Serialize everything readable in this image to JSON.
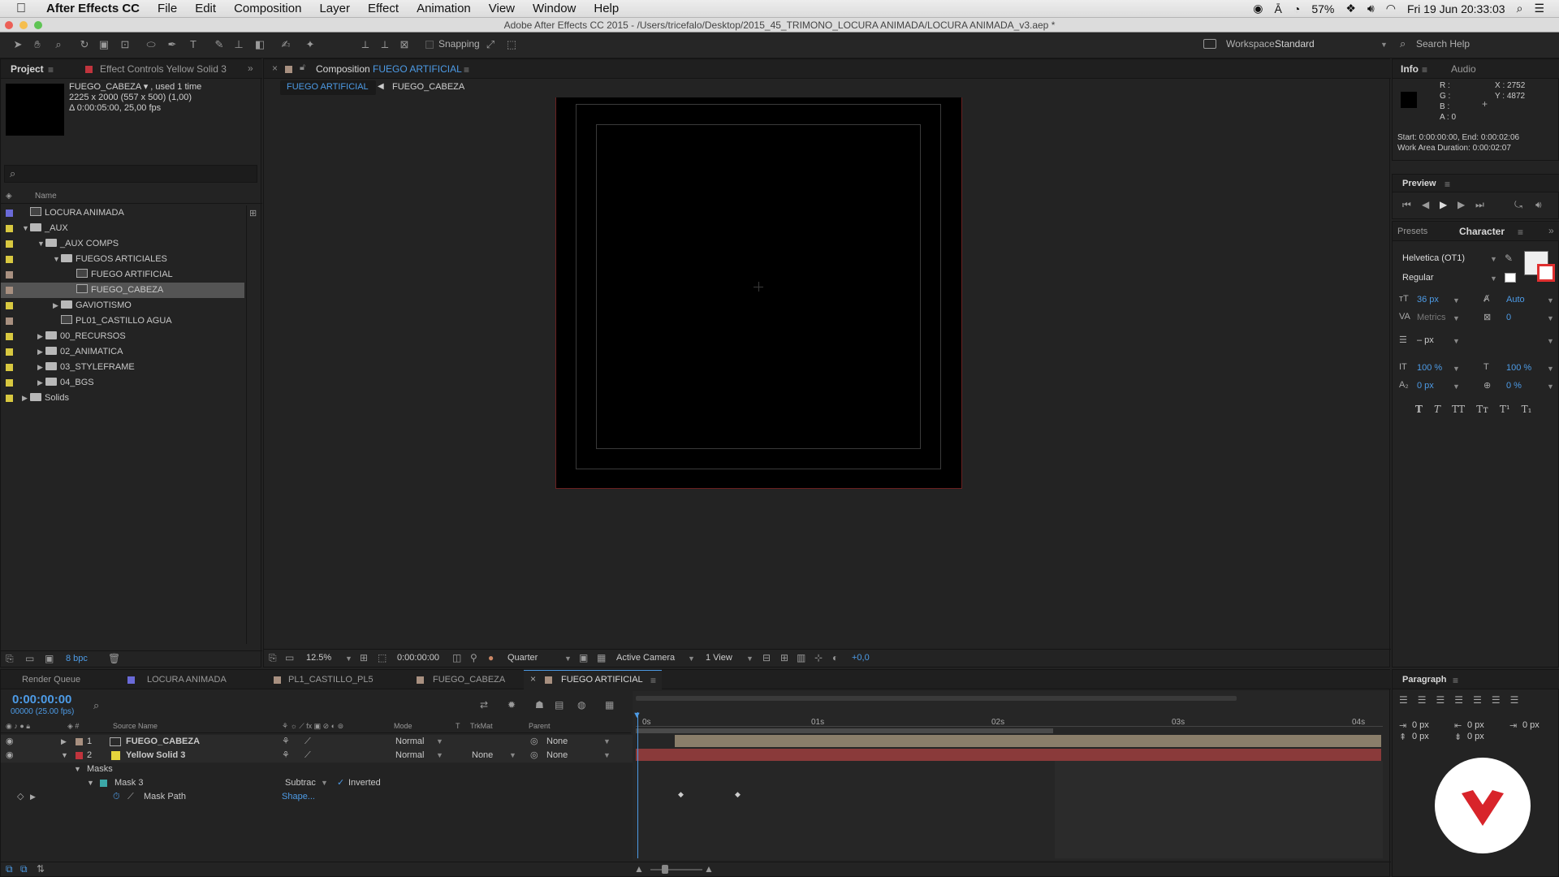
{
  "menubar": {
    "apple": "",
    "app": "After Effects CC",
    "items": [
      "File",
      "Edit",
      "Composition",
      "Layer",
      "Effect",
      "Animation",
      "View",
      "Window",
      "Help"
    ],
    "battery": "57%",
    "datetime": "Fri 19 Jun  20:33:03"
  },
  "window": {
    "title": "Adobe After Effects CC 2015 - /Users/tricefalo/Desktop/2015_45_TRIMONO_LOCURA ANIMADA/LOCURA ANIMADA_v3.aep *"
  },
  "toolbar": {
    "snapping": "Snapping",
    "workspace_label": "Workspace:",
    "workspace_value": "Standard",
    "search_help": "Search Help"
  },
  "project": {
    "tab_project": "Project",
    "tab_effect_controls": "Effect Controls Yellow Solid 3",
    "info_name": "FUEGO_CABEZA ▾ , used 1 time",
    "info_size": "2225 x 2000  (557 x 500) (1,00)",
    "info_duration": "Δ 0:00:05:00, 25,00 fps",
    "col_name": "Name",
    "bpc": "8 bpc",
    "items": [
      {
        "label": "LOCURA ANIMADA",
        "type": "comp",
        "indent": 0,
        "tri": "",
        "color": "#6a6ad8"
      },
      {
        "label": "_AUX",
        "type": "folder",
        "indent": 0,
        "tri": "▼",
        "color": "#d8c840"
      },
      {
        "label": "_AUX COMPS",
        "type": "folder",
        "indent": 1,
        "tri": "▼",
        "color": "#d8c840"
      },
      {
        "label": "FUEGOS ARTICIALES",
        "type": "folder",
        "indent": 2,
        "tri": "▼",
        "color": "#d8c840"
      },
      {
        "label": "FUEGO ARTIFICIAL",
        "type": "comp",
        "indent": 3,
        "tri": "",
        "color": "#a89080"
      },
      {
        "label": "FUEGO_CABEZA",
        "type": "comp",
        "indent": 3,
        "tri": "",
        "color": "#a89080"
      },
      {
        "label": "GAVIOTISMO",
        "type": "folder",
        "indent": 2,
        "tri": "▶",
        "color": "#d8c840"
      },
      {
        "label": "PL01_CASTILLO AGUA",
        "type": "comp",
        "indent": 2,
        "tri": "",
        "color": "#a89080"
      },
      {
        "label": "00_RECURSOS",
        "type": "folder",
        "indent": 1,
        "tri": "▶",
        "color": "#d8c840"
      },
      {
        "label": "02_ANIMATICA",
        "type": "folder",
        "indent": 1,
        "tri": "▶",
        "color": "#d8c840"
      },
      {
        "label": "03_STYLEFRAME",
        "type": "folder",
        "indent": 1,
        "tri": "▶",
        "color": "#d8c840"
      },
      {
        "label": "04_BGS",
        "type": "folder",
        "indent": 1,
        "tri": "▶",
        "color": "#d8c840"
      },
      {
        "label": "Solids",
        "type": "folder",
        "indent": 0,
        "tri": "▶",
        "color": "#d8c840"
      }
    ]
  },
  "comp": {
    "tab_prefix": "Composition",
    "tab_name": "FUEGO ARTIFICIAL",
    "crumb1": "FUEGO ARTIFICIAL",
    "crumb2": "FUEGO_CABEZA",
    "zoom": "12.5%",
    "timecode": "0:00:00:00",
    "resolution": "Quarter",
    "camera": "Active Camera",
    "views": "1 View",
    "exposure": "+0,0"
  },
  "info": {
    "tab_info": "Info",
    "tab_audio": "Audio",
    "r": "R :",
    "g": "G :",
    "b": "B :",
    "a": "A : 0",
    "x": "X : 2752",
    "y": "Y : 4872",
    "start_end": "Start: 0:00:00:00, End: 0:00:02:06",
    "work_area": "Work Area Duration: 0:00:02:07"
  },
  "preview": {
    "title": "Preview"
  },
  "character": {
    "tab_presets": "Presets",
    "tab_character": "Character",
    "font": "Helvetica (OT1)",
    "style": "Regular",
    "size": "36 px",
    "leading": "Auto",
    "kerning": "Metrics",
    "tracking": "0",
    "stroke": "– px",
    "vscale": "100 %",
    "hscale": "100 %",
    "baseline": "0 px",
    "tsume": "0 %",
    "styles": [
      "T",
      "T",
      "TT",
      "Tт",
      "T¹",
      "T₁"
    ]
  },
  "paragraph": {
    "title": "Paragraph",
    "indent_left": "0 px",
    "indent_first": "0 px",
    "indent_right": "0 px",
    "space_before": "0 px",
    "space_after": "0 px"
  },
  "timeline": {
    "tabs": [
      "Render Queue",
      "LOCURA ANIMADA",
      "PL1_CASTILLO_PL5",
      "FUEGO_CABEZA",
      "FUEGO ARTIFICIAL"
    ],
    "timecode": "0:00:00:00",
    "fps": "00000 (25.00 fps)",
    "col_source": "Source Name",
    "col_mode": "Mode",
    "col_t": "T",
    "col_trkmat": "TrkMat",
    "col_parent": "Parent",
    "ruler": [
      "0s",
      "01s",
      "02s",
      "03s",
      "04s"
    ],
    "layers": [
      {
        "num": "1",
        "name": "FUEGO_CABEZA",
        "mode": "Normal",
        "trkmat": "",
        "parent": "None",
        "color": "#a89080"
      },
      {
        "num": "2",
        "name": "Yellow Solid 3",
        "mode": "Normal",
        "trkmat": "None",
        "parent": "None",
        "color": "#d8c840"
      }
    ],
    "masks_label": "Masks",
    "mask_name": "Mask 3",
    "mask_mode": "Subtrac",
    "inverted": "Inverted",
    "mask_path": "Mask Path",
    "shape_link": "Shape..."
  }
}
